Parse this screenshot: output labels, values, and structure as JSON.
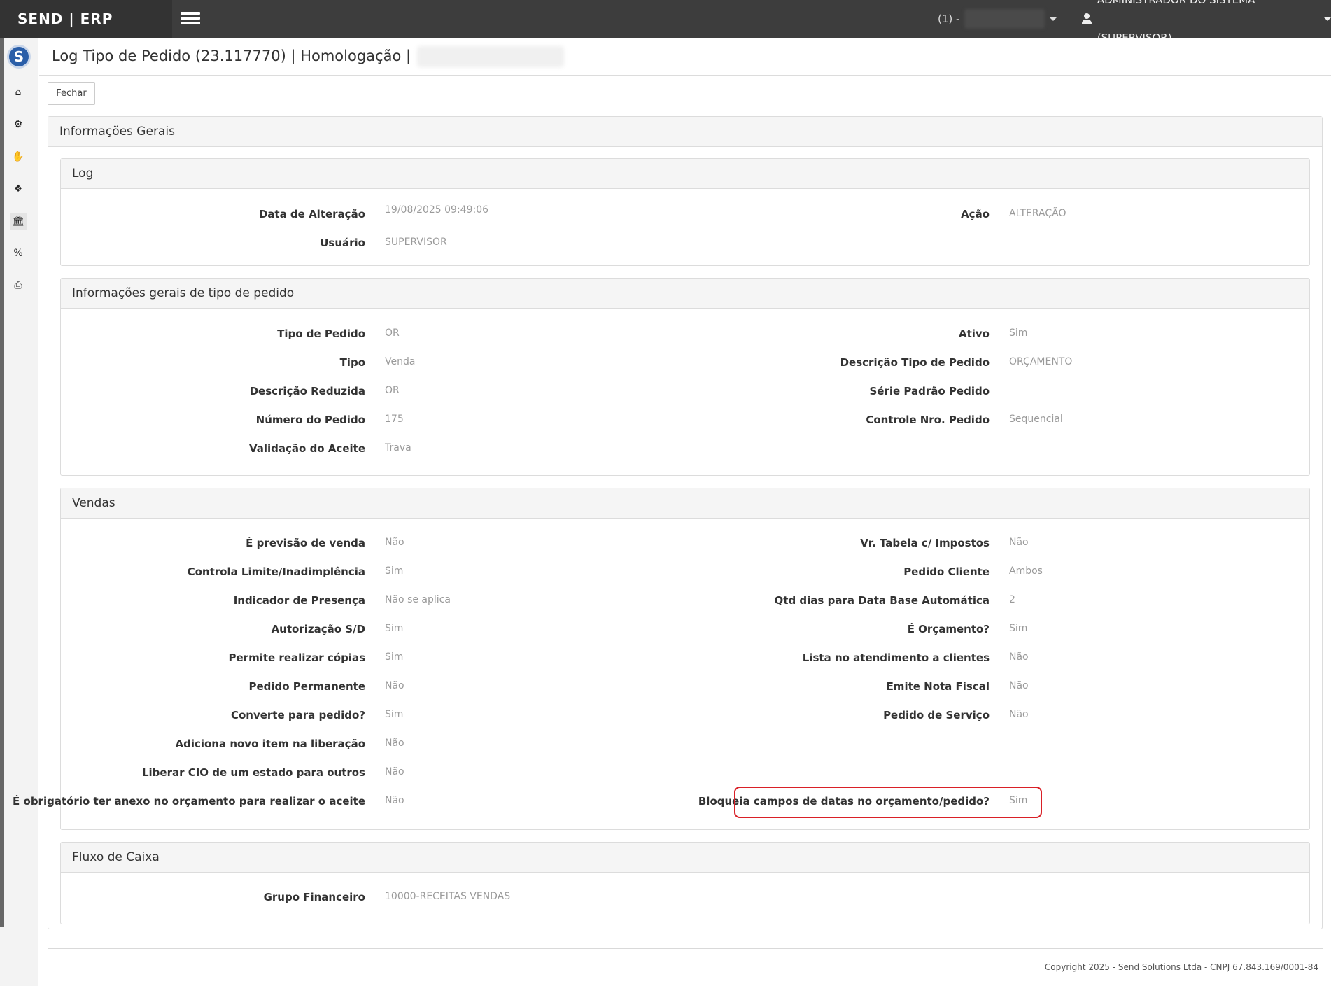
{
  "app": {
    "brand": "SEND | ERP"
  },
  "topbar": {
    "environment_prefix": "(1) -",
    "user": "ADMINISTRADOR DO SISTEMA (SUPERVISOR)"
  },
  "sidebar": {
    "logo": "S",
    "icons": [
      "home-icon",
      "cogs-icon",
      "handshake-icon",
      "cubes-icon",
      "bank-icon",
      "percent-icon",
      "print-icon"
    ]
  },
  "page": {
    "title": "Log Tipo de Pedido (23.117770)  |  Homologação  |",
    "close_button": "Fechar",
    "outer_panel_title": "Informações Gerais"
  },
  "log": {
    "title": "Log",
    "data_alteracao_label": "Data de Alteração",
    "data_alteracao_value": "19/08/2025 09:49:06",
    "acao_label": "Ação",
    "acao_value": "ALTERAÇÃO",
    "usuario_label": "Usuário",
    "usuario_value": "SUPERVISOR"
  },
  "info": {
    "title": "Informações gerais de tipo de pedido",
    "left": [
      {
        "label": "Tipo de Pedido",
        "value": "OR"
      },
      {
        "label": "Tipo",
        "value": "Venda"
      },
      {
        "label": "Descrição Reduzida",
        "value": "OR"
      },
      {
        "label": "Número do Pedido",
        "value": "175"
      },
      {
        "label": "Validação do Aceite",
        "value": "Trava"
      }
    ],
    "right": [
      {
        "label": "Ativo",
        "value": "Sim"
      },
      {
        "label": "Descrição Tipo de Pedido",
        "value": "ORÇAMENTO"
      },
      {
        "label": "Série Padrão Pedido",
        "value": ""
      },
      {
        "label": "Controle Nro. Pedido",
        "value": "Sequencial"
      }
    ]
  },
  "vendas": {
    "title": "Vendas",
    "left": [
      {
        "label": "É previsão de venda",
        "value": "Não"
      },
      {
        "label": "Controla Limite/Inadimplência",
        "value": "Sim"
      },
      {
        "label": "Indicador de Presença",
        "value": "Não se aplica"
      },
      {
        "label": "Autorização S/D",
        "value": "Sim"
      },
      {
        "label": "Permite realizar cópias",
        "value": "Sim"
      },
      {
        "label": "Pedido Permanente",
        "value": "Não"
      },
      {
        "label": "Converte para pedido?",
        "value": "Sim"
      },
      {
        "label": "Adiciona novo item na liberação",
        "value": "Não"
      },
      {
        "label": "Liberar CIO de um estado para outros",
        "value": "Não"
      },
      {
        "label": "É obrigatório ter anexo no orçamento para realizar o aceite",
        "value": "Não"
      }
    ],
    "right": [
      {
        "label": "Vr. Tabela c/ Impostos",
        "value": "Não"
      },
      {
        "label": "Pedido Cliente",
        "value": "Ambos"
      },
      {
        "label": "Qtd dias para Data Base Automática",
        "value": "2"
      },
      {
        "label": "É Orçamento?",
        "value": "Sim"
      },
      {
        "label": "Lista no atendimento a clientes",
        "value": "Não"
      },
      {
        "label": "Emite Nota Fiscal",
        "value": "Não"
      },
      {
        "label": "Pedido de Serviço",
        "value": "Não"
      },
      {
        "label": "",
        "value": ""
      },
      {
        "label": "",
        "value": ""
      },
      {
        "label": "Bloqueia campos de datas no orçamento/pedido?",
        "value": "Sim"
      }
    ]
  },
  "fluxo": {
    "title": "Fluxo de Caixa",
    "grupo_label": "Grupo Financeiro",
    "grupo_value": "10000-RECEITAS VENDAS"
  },
  "footer": {
    "copyright": "Copyright 2025 - Send Solutions Ltda - CNPJ 67.843.169/0001-84"
  },
  "colors": {
    "topbar": "#3d3d3d",
    "highlight": "#d92027",
    "value_text": "#9a9a9a"
  }
}
